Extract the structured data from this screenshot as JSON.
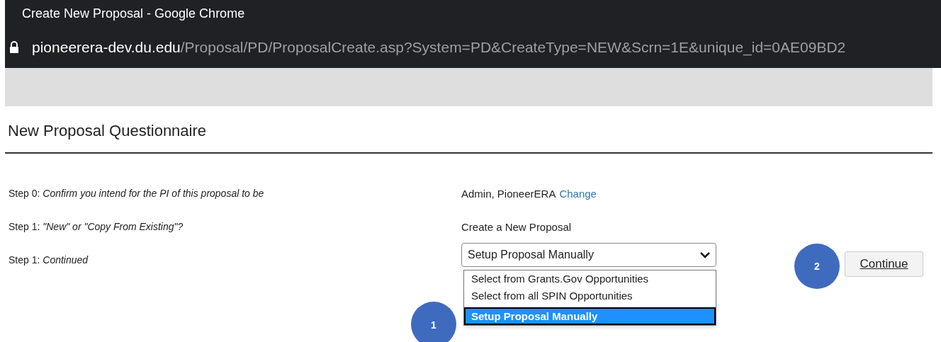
{
  "window": {
    "title": "Create New Proposal - Google Chrome"
  },
  "address_bar": {
    "host": "pioneerera-dev.du.edu",
    "path": "/Proposal/PD/ProposalCreate.asp?System=PD&CreateType=NEW&Scrn=1E&unique_id=0AE09BD2"
  },
  "page": {
    "heading": "New Proposal Questionnaire"
  },
  "steps": [
    {
      "label": "Step 0: *Confirm you intend for the PI of this proposal to be*",
      "kind": "text_with_link",
      "value": "Admin, PioneerERA",
      "link": "Change"
    },
    {
      "label": "Step 1: *\"New\" or \"Copy From Existing\"?*",
      "kind": "text",
      "value": "Create a New Proposal"
    },
    {
      "label": "Step 1: *Continued*",
      "kind": "dropdown",
      "value": "Setup Proposal Manually",
      "expanded": true,
      "options": [
        {
          "label": "Select from Grants.Gov Opportunities",
          "selected": false
        },
        {
          "label": "Select from all SPIN Opportunities",
          "selected": false
        },
        {
          "label": "Setup Proposal Manually",
          "selected": true
        }
      ]
    }
  ],
  "continue_button": "Continue",
  "callouts": [
    "1",
    "2"
  ]
}
